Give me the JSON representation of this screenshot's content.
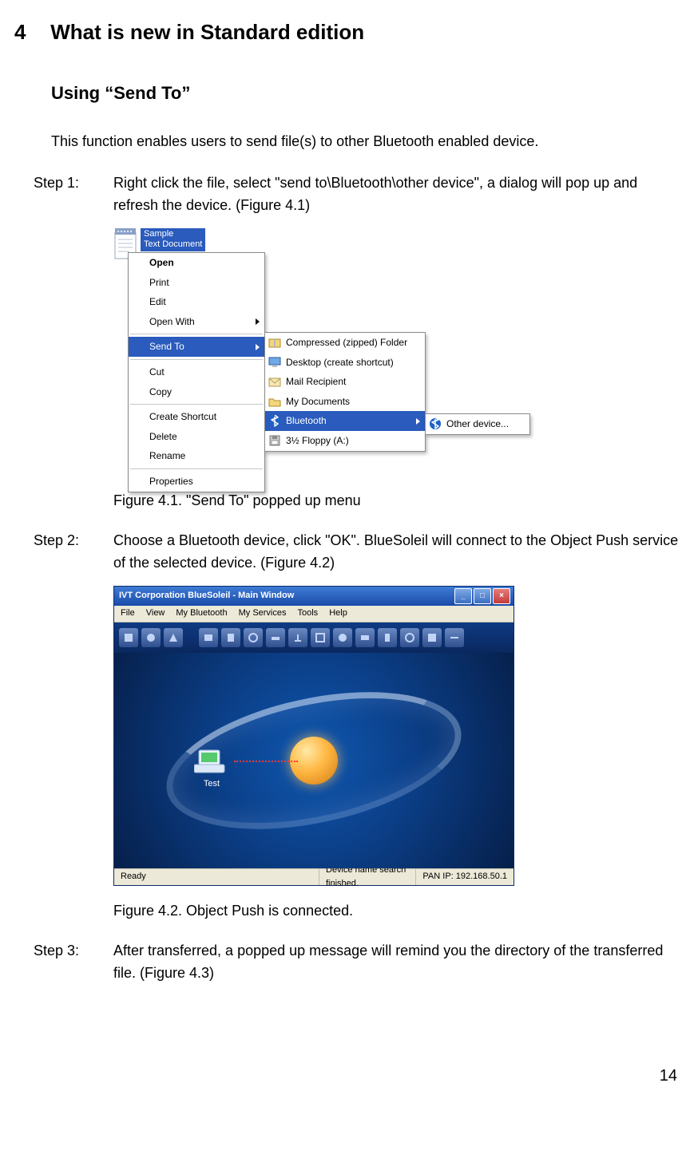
{
  "heading": {
    "number": "4",
    "title": "What is new in Standard edition"
  },
  "subheading": "Using “Send To”",
  "intro": "This function enables users to send file(s) to other Bluetooth enabled device.",
  "steps": {
    "s1": {
      "label": "Step 1:",
      "text": "Right click the file, select \"send to\\Bluetooth\\other device\", a dialog will pop up and refresh the device. (Figure 4.1)"
    },
    "s2": {
      "label": "Step 2:",
      "text": "Choose a Bluetooth device, click \"OK\". BlueSoleil will connect to the Object Push service of the selected device. (Figure 4.2)"
    },
    "s3": {
      "label": "Step 3:",
      "text": "After transferred, a popped up message will remind you the directory of the transferred file. (Figure 4.3)"
    }
  },
  "captions": {
    "c1": "Figure 4.1. \"Send To\" popped up menu",
    "c2": "Figure 4.2. Object Push is connected."
  },
  "page_number": "14",
  "fig41": {
    "file": {
      "name_line1": "Sample",
      "name_line2": "Text Document"
    },
    "menu1": {
      "open": "Open",
      "print": "Print",
      "edit": "Edit",
      "open_with": "Open With",
      "send_to": "Send To",
      "cut": "Cut",
      "copy": "Copy",
      "create_shortcut": "Create Shortcut",
      "delete": "Delete",
      "rename": "Rename",
      "properties": "Properties"
    },
    "menu2": {
      "zip": "Compressed (zipped) Folder",
      "desktop": "Desktop (create shortcut)",
      "mail": "Mail Recipient",
      "mydocs": "My Documents",
      "bluetooth": "Bluetooth",
      "floppy": "3½ Floppy (A:)"
    },
    "menu3": {
      "other": "Other device..."
    }
  },
  "fig42": {
    "title": "IVT Corporation BlueSoleil - Main Window",
    "menu": {
      "file": "File",
      "view": "View",
      "my_bluetooth": "My Bluetooth",
      "my_services": "My Services",
      "tools": "Tools",
      "help": "Help"
    },
    "device_label": "Test",
    "status": {
      "left": "Ready",
      "center": "Device name search finished.",
      "right": "PAN IP: 192.168.50.1"
    }
  }
}
